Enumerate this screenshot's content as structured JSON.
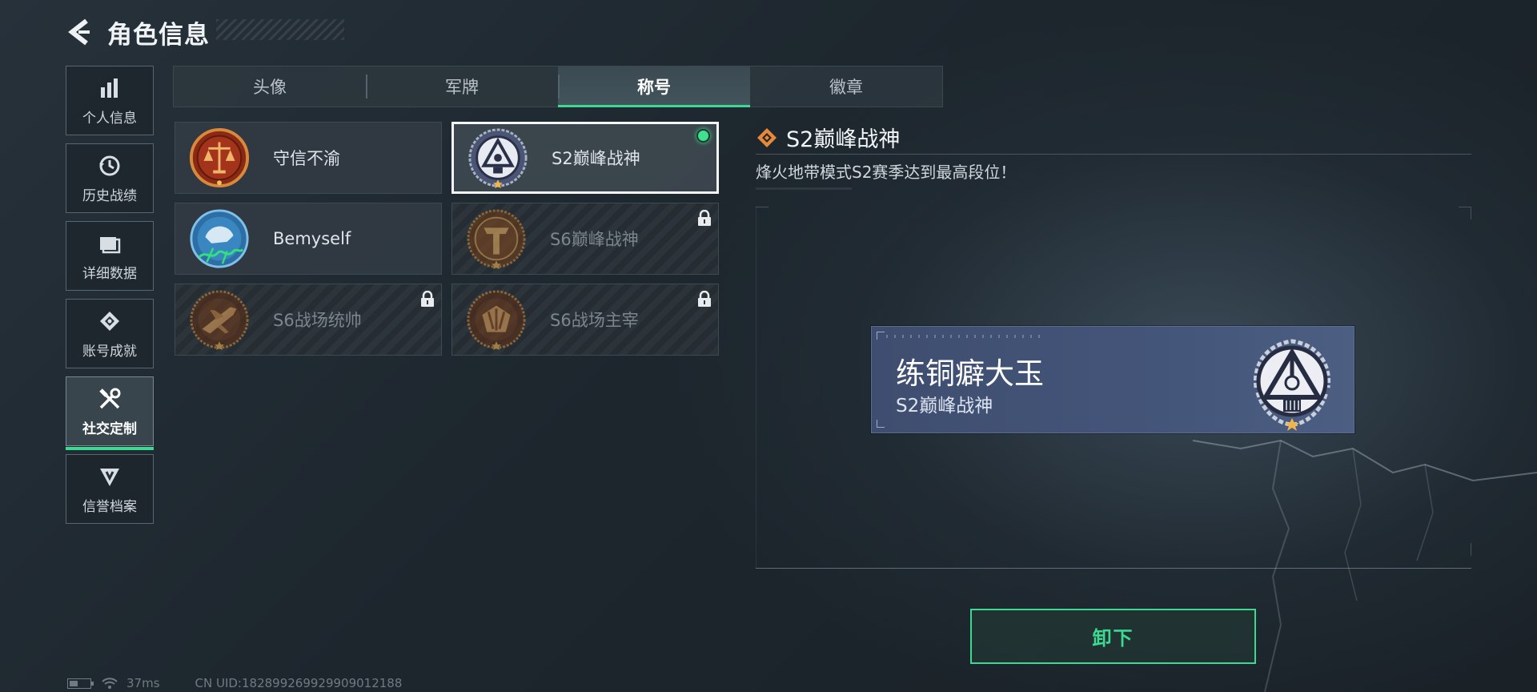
{
  "header": {
    "title": "角色信息"
  },
  "sidebar": {
    "items": [
      {
        "label": "个人信息",
        "icon": "bar-chart-icon"
      },
      {
        "label": "历史战绩",
        "icon": "history-icon"
      },
      {
        "label": "详细数据",
        "icon": "folder-icon"
      },
      {
        "label": "账号成就",
        "icon": "achievement-icon"
      },
      {
        "label": "社交定制",
        "icon": "tools-icon",
        "active": true
      },
      {
        "label": "信誉档案",
        "icon": "credit-shield-icon"
      }
    ]
  },
  "tabs": [
    {
      "label": "头像"
    },
    {
      "label": "军牌"
    },
    {
      "label": "称号",
      "active": true
    },
    {
      "label": "徽章"
    }
  ],
  "titles": [
    {
      "label": "守信不渝",
      "icon": "scales-emblem-icon",
      "locked": false,
      "selected": false
    },
    {
      "label": "S2巅峰战神",
      "icon": "tripod-emblem-icon",
      "locked": false,
      "selected": true,
      "equipped": true
    },
    {
      "label": "Bemyself",
      "icon": "signature-emblem-icon",
      "locked": false,
      "selected": false
    },
    {
      "label": "S6巅峰战神",
      "icon": "t-emblem-icon",
      "locked": true,
      "selected": false
    },
    {
      "label": "S6战场统帅",
      "icon": "jet-emblem-icon",
      "locked": true,
      "selected": false
    },
    {
      "label": "S6战场主宰",
      "icon": "rockets-emblem-icon",
      "locked": true,
      "selected": false
    }
  ],
  "detail": {
    "title": "S2巅峰战神",
    "description": "烽火地带模式S2赛季达到最高段位！"
  },
  "preview": {
    "player_name": "练铜癖大玉",
    "title": "S2巅峰战神"
  },
  "actions": {
    "unequip_label": "卸下"
  },
  "status": {
    "ping": "37ms",
    "uid": "CN UID:18289926992990901218​8"
  },
  "colors": {
    "accent_green": "#3dd993",
    "orange": "#e58a3c",
    "nameplate_blue": "#44557a"
  }
}
